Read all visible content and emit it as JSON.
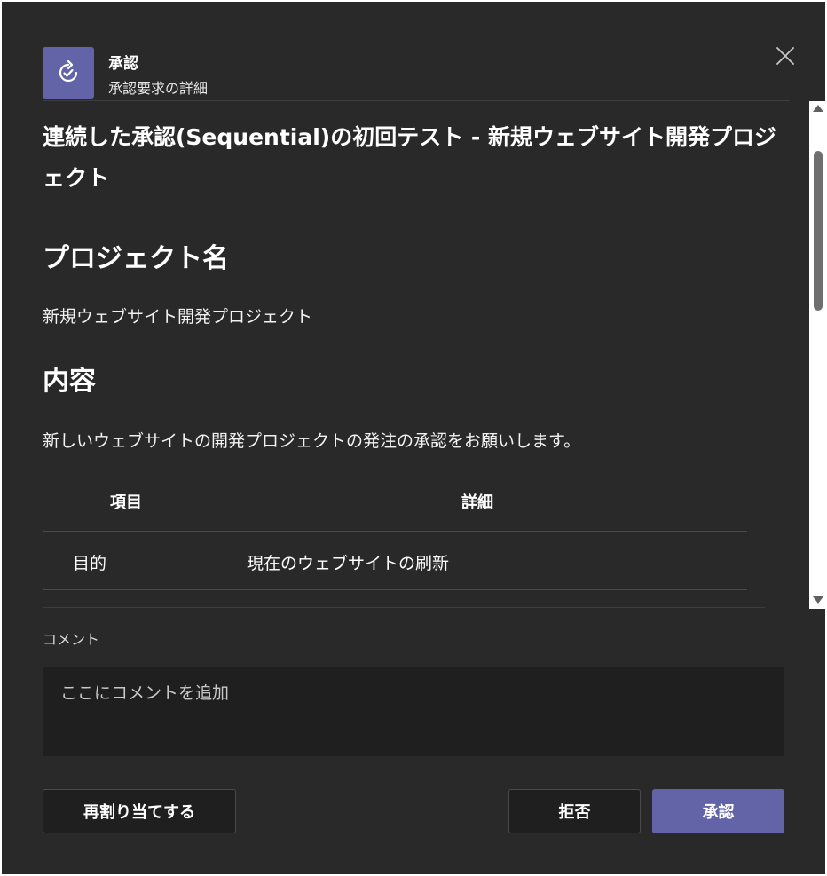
{
  "header": {
    "app_name": "承認",
    "app_subtitle": "承認要求の詳細",
    "app_icon": "approvals-refresh-icon",
    "close_icon": "close-icon"
  },
  "card": {
    "title": "連続した承認(Sequential)の初回テスト - 新規ウェブサイト開発プロジェクト",
    "project_heading": "プロジェクト名",
    "project_name": "新規ウェブサイト開発プロジェクト",
    "content_heading": "内容",
    "content_text": "新しいウェブサイトの開発プロジェクトの発注の承認をお願いします。",
    "table": {
      "headers": [
        "項目",
        "詳細"
      ],
      "rows": [
        [
          "目的",
          "現在のウェブサイトの刷新"
        ]
      ]
    }
  },
  "comment": {
    "label": "コメント",
    "placeholder": "ここにコメントを追加"
  },
  "buttons": {
    "reassign": "再割り当てする",
    "reject": "拒否",
    "approve": "承認"
  },
  "colors": {
    "background": "#292929",
    "accent": "#6264a7",
    "input_bg": "#1f1f1f"
  }
}
